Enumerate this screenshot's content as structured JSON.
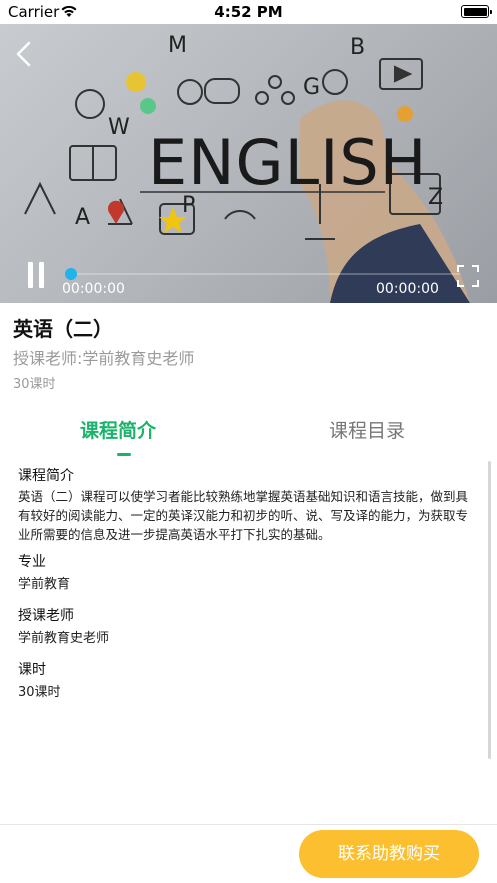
{
  "status_bar": {
    "carrier": "Carrier",
    "time": "4:52 PM"
  },
  "video": {
    "banner_text": "ENGLISH",
    "current_time": "00:00:00",
    "total_time": "00:00:00",
    "progress": 0,
    "icons": [
      "back-icon",
      "pause-icon",
      "fullscreen-icon"
    ]
  },
  "course": {
    "title": "英语（二）",
    "teacher": "授课老师:学前教育史老师",
    "hours": "30课时"
  },
  "tabs": [
    {
      "label": "课程简介",
      "active": true
    },
    {
      "label": "课程目录",
      "active": false
    }
  ],
  "details": {
    "intro_label": "课程简介",
    "intro_text": "英语（二）课程可以使学习者能比较熟练地掌握英语基础知识和语言技能，做到具有较好的阅读能力、一定的英译汉能力和初步的听、说、写及译的能力，为获取专业所需要的信息及进一步提高英语水平打下扎实的基础。",
    "major_label": "专业",
    "major_value": "学前教育",
    "teacher_label": "授课老师",
    "teacher_value": "学前教育史老师",
    "hours_label": "课时",
    "hours_value": "30课时"
  },
  "footer": {
    "buy_button_label": "联系助教购买"
  },
  "colors": {
    "accent_green": "#1bb36b",
    "button_yellow": "#fbbf2f",
    "progress_blue": "#1fb4ea"
  }
}
